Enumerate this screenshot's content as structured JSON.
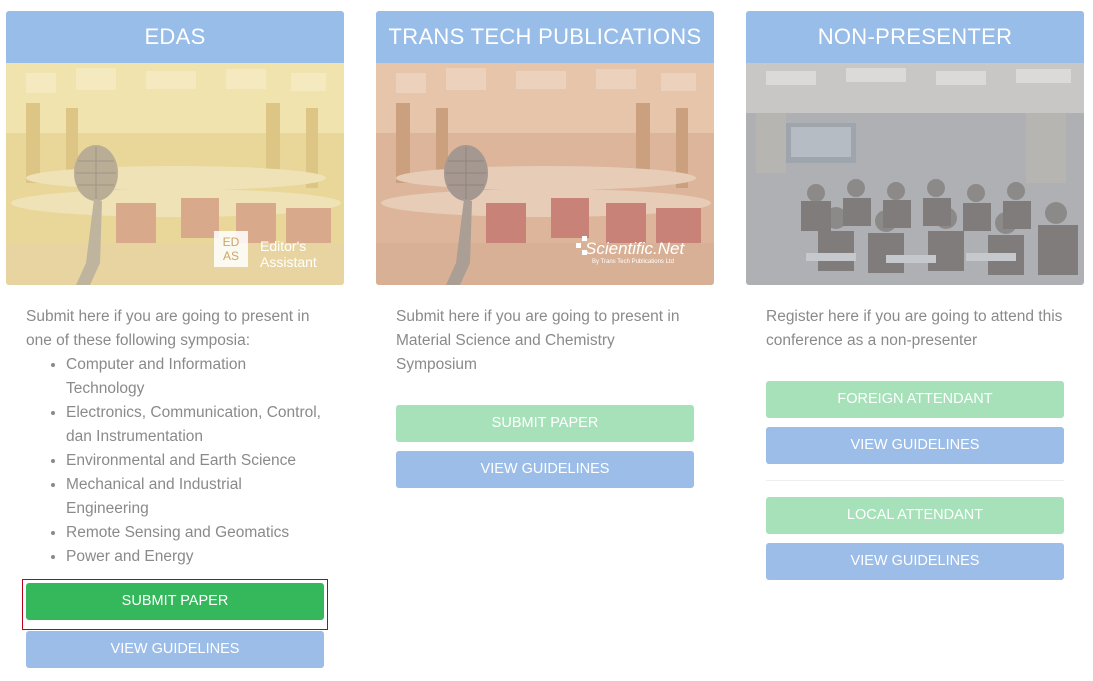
{
  "colors": {
    "header_blue": "#97bde8",
    "button_green_light": "#a6e1b9",
    "button_green": "#35b75b",
    "button_blue": "#9bbde8",
    "text_gray": "#8a8a8a",
    "highlight_red": "#c0001a"
  },
  "cards": [
    {
      "title": "EDAS",
      "image_badge": {
        "logo_line1": "ED",
        "logo_line2": "AS",
        "text_line1": "Editor's",
        "text_line2": "Assistant"
      },
      "description": "Submit here if you are going to present in one of these following symposia:",
      "symposia": [
        "Computer and Information Technology",
        "Electronics, Communication, Control, dan Instrumentation",
        "Environmental and Earth Science",
        "Mechanical and Industrial Engineering",
        "Remote Sensing and Geomatics",
        "Power and Energy"
      ],
      "submit_label": "SUBMIT PAPER",
      "guidelines_label": "VIEW GUIDELINES"
    },
    {
      "title": "TRANS TECH PUBLICATIONS",
      "image_badge": {
        "logo_text": "Scientific.Net",
        "logo_sub": "By Trans Tech Publications Ltd"
      },
      "description": "Submit here if you are going to present in Material Science and Chemistry Symposium",
      "submit_label": "SUBMIT PAPER",
      "guidelines_label": "VIEW GUIDELINES"
    },
    {
      "title": "NON-PRESENTER",
      "description": "Register here if you are going to attend this conference as a non-presenter",
      "foreign_label": "FOREIGN ATTENDANT",
      "foreign_guidelines_label": "VIEW GUIDELINES",
      "local_label": "LOCAL ATTENDANT",
      "local_guidelines_label": "VIEW GUIDELINES"
    }
  ]
}
